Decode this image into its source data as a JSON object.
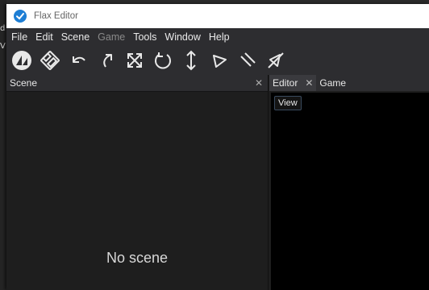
{
  "window": {
    "title": "Flax Editor",
    "logo_icon": "flax-logo-icon"
  },
  "background": {
    "left_fragments": [
      "d",
      "V"
    ]
  },
  "menubar": {
    "items": [
      {
        "label": "File",
        "enabled": true
      },
      {
        "label": "Edit",
        "enabled": true
      },
      {
        "label": "Scene",
        "enabled": true
      },
      {
        "label": "Game",
        "enabled": false
      },
      {
        "label": "Tools",
        "enabled": true
      },
      {
        "label": "Window",
        "enabled": true
      },
      {
        "label": "Help",
        "enabled": true
      }
    ]
  },
  "toolbar": {
    "buttons": [
      {
        "icon": "flax-logo-icon"
      },
      {
        "icon": "save-icon"
      },
      {
        "icon": "undo-icon"
      },
      {
        "icon": "redo-icon"
      },
      {
        "icon": "scale-icon"
      },
      {
        "icon": "rotate-icon"
      },
      {
        "icon": "translate-icon"
      },
      {
        "icon": "play-icon"
      },
      {
        "icon": "pause-icon"
      },
      {
        "icon": "step-icon"
      }
    ]
  },
  "scene_panel": {
    "title": "Scene",
    "close_glyph": "✕",
    "empty_message": "No scene"
  },
  "editor_panel": {
    "tabs": [
      {
        "label": "Editor",
        "active": true,
        "close_glyph": "✕"
      },
      {
        "label": "Game",
        "active": false
      }
    ],
    "view_button": "View"
  },
  "colors": {
    "accent": "#1e7ed4",
    "titlebar": "#ffffff",
    "panel_bg": "#1e1e1e",
    "toolbar_bg": "#2d2d30",
    "viewport_bg": "#000000"
  }
}
